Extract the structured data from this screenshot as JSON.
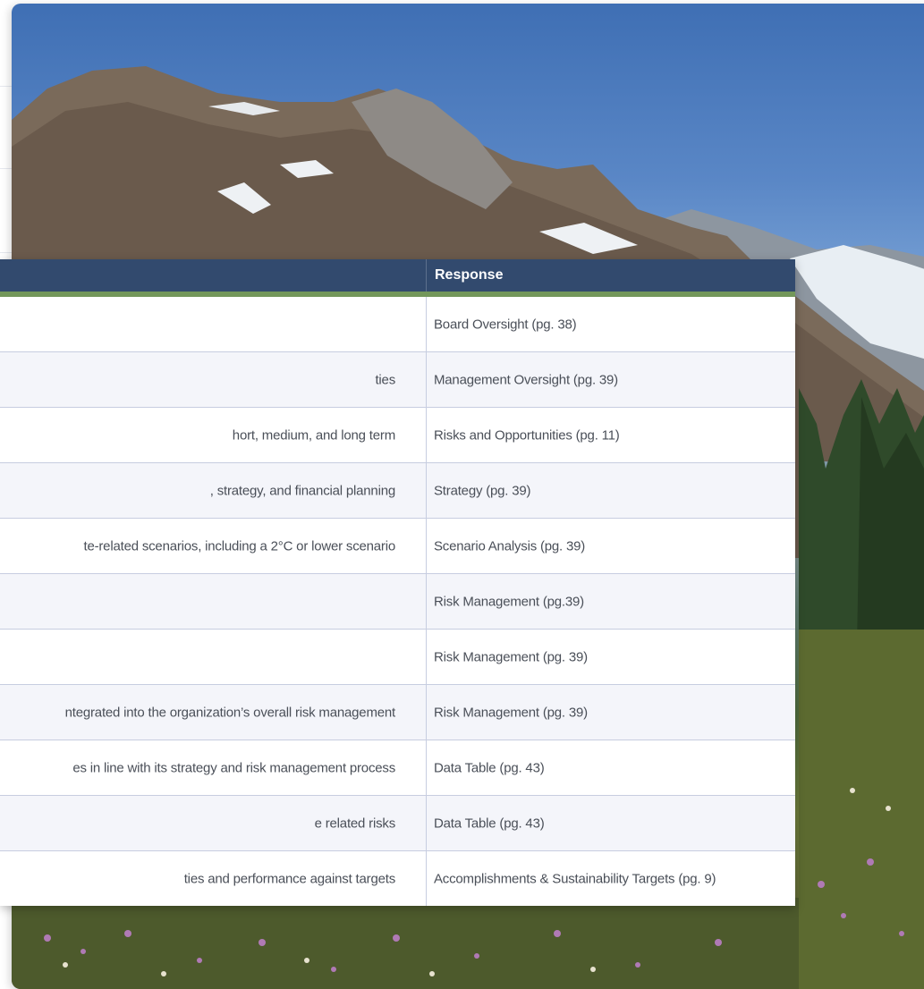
{
  "table": {
    "response_header": "Response",
    "rows": [
      {
        "disclosure": "",
        "response": "Board Oversight (pg. 38)"
      },
      {
        "disclosure": "ties",
        "response": "Management Oversight (pg. 39)"
      },
      {
        "disclosure": "hort, medium, and long term",
        "response": "Risks and Opportunities (pg. 11)"
      },
      {
        "disclosure": ", strategy, and financial planning",
        "response": "Strategy (pg. 39)"
      },
      {
        "disclosure": "te-related scenarios, including a 2°C or lower scenario",
        "response": "Scenario Analysis (pg. 39)"
      },
      {
        "disclosure": "",
        "response": "Risk Management (pg.39)"
      },
      {
        "disclosure": "",
        "response": "Risk Management (pg. 39)"
      },
      {
        "disclosure": "ntegrated into the organization’s overall risk management",
        "response": "Risk Management (pg. 39)"
      },
      {
        "disclosure": "es in line with its strategy and risk management process",
        "response": "Data Table (pg. 43)"
      },
      {
        "disclosure": "e related risks",
        "response": "Data Table (pg. 43)"
      },
      {
        "disclosure": "ties and performance against targets",
        "response": "Accomplishments & Sustainability Targets (pg. 9)"
      }
    ]
  },
  "colors": {
    "header_bg": "#324a6e",
    "accent_bar": "#73975a",
    "row_alt": "#f4f5fa"
  }
}
